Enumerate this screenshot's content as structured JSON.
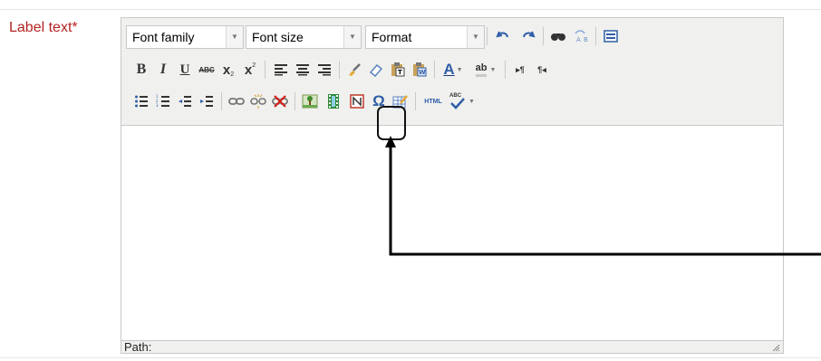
{
  "field": {
    "label": "Label text",
    "required_marker": "*"
  },
  "toolbar": {
    "font_family_select": {
      "value": "Font family"
    },
    "font_size_select": {
      "value": "Font size"
    },
    "format_select": {
      "value": "Format"
    },
    "row1_buttons": [
      "undo-icon",
      "redo-icon",
      "find-icon",
      "replace-icon",
      "fullscreen-icon"
    ],
    "row2_buttons": [
      "bold",
      "italic",
      "underline",
      "strikethrough",
      "subscript",
      "superscript",
      "align-left",
      "align-center",
      "align-right",
      "cleanup",
      "remove-format",
      "paste-text",
      "paste-word",
      "text-color",
      "background-color",
      "ltr",
      "rtl"
    ],
    "row3_buttons": [
      "bulleted-list",
      "numbered-list",
      "outdent",
      "indent",
      "link",
      "unlink",
      "no-link",
      "insert-image",
      "insert-media",
      "nonbreaking-space",
      "special-character",
      "table",
      "html-source",
      "spellcheck"
    ],
    "labels": {
      "bold": "B",
      "italic": "I",
      "underline": "U",
      "strike": "ABC",
      "subscript": "x",
      "superscript": "x",
      "omega": "Ω",
      "html": "HTML",
      "abc": "ABC",
      "color_a": "A",
      "bg_ab": "ab"
    }
  },
  "statusbar": {
    "path_label": "Path:"
  },
  "colors": {
    "label_red": "#b22222",
    "border": "#c8c8c8",
    "toolbar_bg": "#f0f0ee",
    "media_icon_green": "#2f8a3a",
    "callout_black": "#111111"
  }
}
